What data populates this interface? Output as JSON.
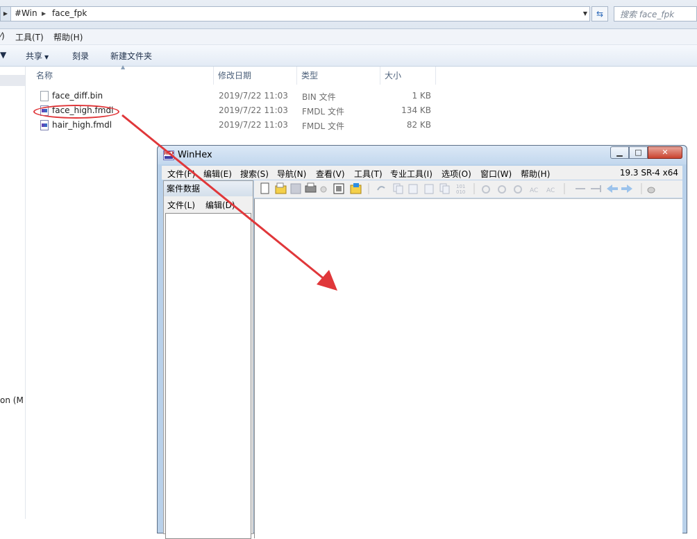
{
  "explorer": {
    "address": {
      "crumbs": [
        "#Win",
        "face_fpk"
      ],
      "search_placeholder": "搜索 face_fpk"
    },
    "menu": [
      "⁄)",
      "工具(T)",
      "帮助(H)"
    ],
    "toolbar": {
      "share_label": "共享",
      "burn_label": "刻录",
      "new_folder_label": "新建文件夹"
    },
    "nav_partial_text": "on (M",
    "columns": {
      "name": "名称",
      "modified": "修改日期",
      "type": "类型",
      "size": "大小"
    },
    "files": [
      {
        "name": "face_diff.bin",
        "modified": "2019/7/22 11:03",
        "type": "BIN 文件",
        "size": "1 KB",
        "icon": "bin-file-icon"
      },
      {
        "name": "face_high.fmdl",
        "modified": "2019/7/22 11:03",
        "type": "FMDL 文件",
        "size": "134 KB",
        "icon": "fmdl-file-icon"
      },
      {
        "name": "hair_high.fmdl",
        "modified": "2019/7/22 11:03",
        "type": "FMDL 文件",
        "size": "82 KB",
        "icon": "fmdl-file-icon"
      }
    ]
  },
  "winhex": {
    "title": "WinHex",
    "version": "19.3 SR-4 x64",
    "menu": [
      "文件(F)",
      "编辑(E)",
      "搜索(S)",
      "导航(N)",
      "查看(V)",
      "工具(T)",
      "专业工具(I)",
      "选项(O)",
      "窗口(W)",
      "帮助(H)"
    ],
    "case_panel": {
      "title": "案件数据",
      "menu": [
        "文件(L)",
        "编辑(D)"
      ]
    },
    "toolbar_icons": [
      "new-file-icon",
      "open-file-icon",
      "save-icon",
      "print-icon",
      "properties-icon",
      "open-folder-icon",
      "undo-icon",
      "copy-icon",
      "cut-icon",
      "paste-icon",
      "paste-special-icon",
      "hex-convert-icon",
      "find-text-icon",
      "find-hex-icon",
      "replace-text-icon",
      "replace-hex-icon",
      "goto-offset-icon",
      "goto-sector-icon",
      "back-icon",
      "forward-icon",
      "disk-icon"
    ]
  },
  "annotation": {
    "color": "#e0373a"
  }
}
